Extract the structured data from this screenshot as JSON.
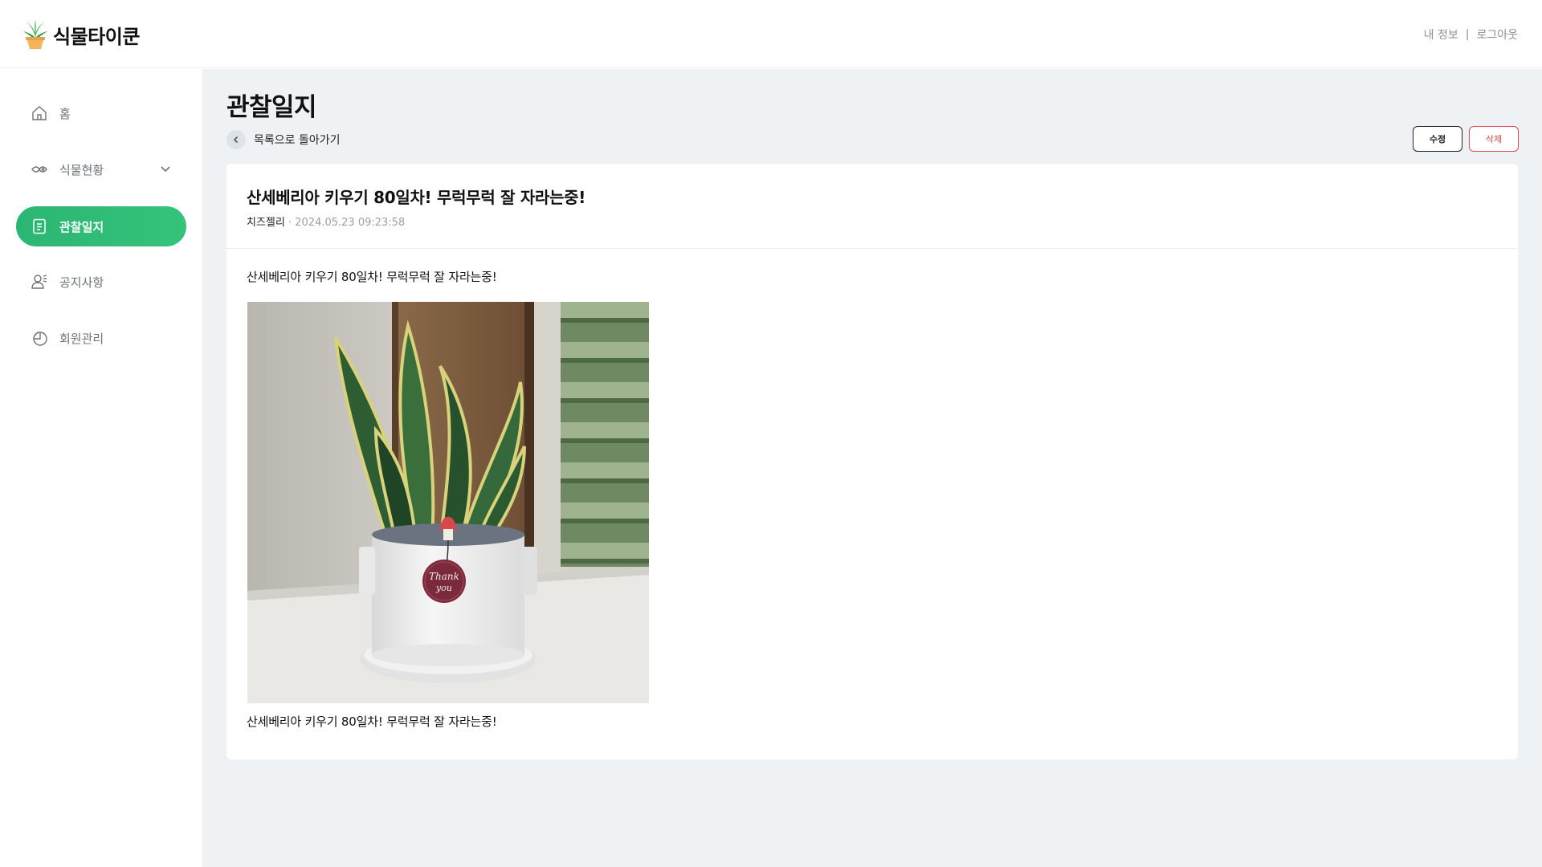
{
  "header": {
    "logo_text": "식물타이쿤",
    "my_info": "내 정보",
    "separator": "|",
    "logout": "로그아웃"
  },
  "sidebar": {
    "items": [
      {
        "label": "홈",
        "icon": "home-icon"
      },
      {
        "label": "식물현황",
        "icon": "plant-status-icon",
        "expandable": true
      },
      {
        "label": "관찰일지",
        "icon": "journal-icon",
        "active": true
      },
      {
        "label": "공지사항",
        "icon": "notice-icon"
      },
      {
        "label": "회원관리",
        "icon": "member-icon"
      }
    ]
  },
  "main": {
    "page_title": "관찰일지",
    "back_label": "목록으로 돌아가기",
    "edit_label": "수정",
    "delete_label": "삭제",
    "post": {
      "title": "산세베리아 키우기 80일차! 무럭무럭 잘 자라는중!",
      "author": "치즈젤리",
      "meta_sep": "·",
      "date": "2024.05.23 09:23:58",
      "text_top": "산세베리아 키우기 80일차! 무럭무럭 잘 자라는중!",
      "tag_line1": "Thank",
      "tag_line2": "you",
      "text_bottom": "산세베리아 키우기 80일차! 무럭무럭 잘 자라는중!"
    }
  },
  "colors": {
    "accent": "#2bb673",
    "danger": "#e5484d",
    "main_bg": "#eff2f5"
  }
}
